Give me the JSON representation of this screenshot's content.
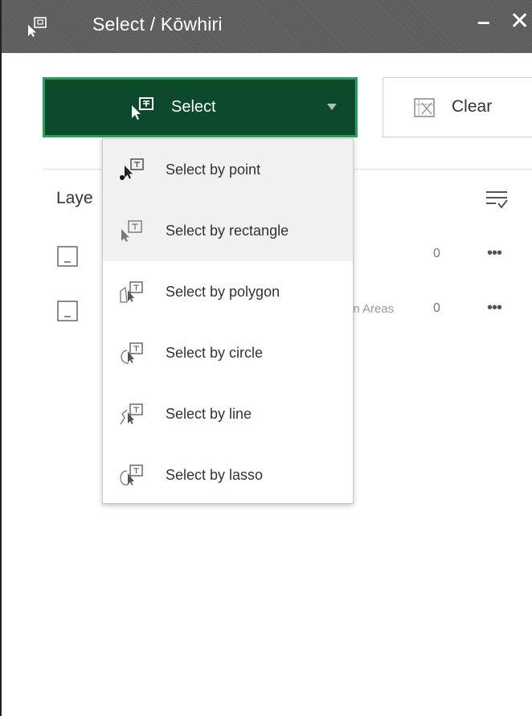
{
  "window": {
    "title": "Select / Kōwhiri",
    "minimize_label": "–",
    "close_label": "✕"
  },
  "toolbar": {
    "select_label": "Select",
    "clear_label": "Clear"
  },
  "layers": {
    "heading_partial": "Laye",
    "rows": [
      {
        "name_fragment": "",
        "count": "0"
      },
      {
        "name_fragment": "on Areas",
        "count": "0"
      }
    ],
    "more_label": "•••"
  },
  "select_menu": {
    "items": [
      {
        "label": "Select by point",
        "icon": "select-point-icon"
      },
      {
        "label": "Select by rectangle",
        "icon": "select-rectangle-icon"
      },
      {
        "label": "Select by polygon",
        "icon": "select-polygon-icon"
      },
      {
        "label": "Select by circle",
        "icon": "select-circle-icon"
      },
      {
        "label": "Select by line",
        "icon": "select-line-icon"
      },
      {
        "label": "Select by lasso",
        "icon": "select-lasso-icon"
      }
    ]
  },
  "colors": {
    "title_bar": "#5a5a5a",
    "select_button_bg": "#0c4a2b",
    "select_button_border": "#21a35c"
  }
}
